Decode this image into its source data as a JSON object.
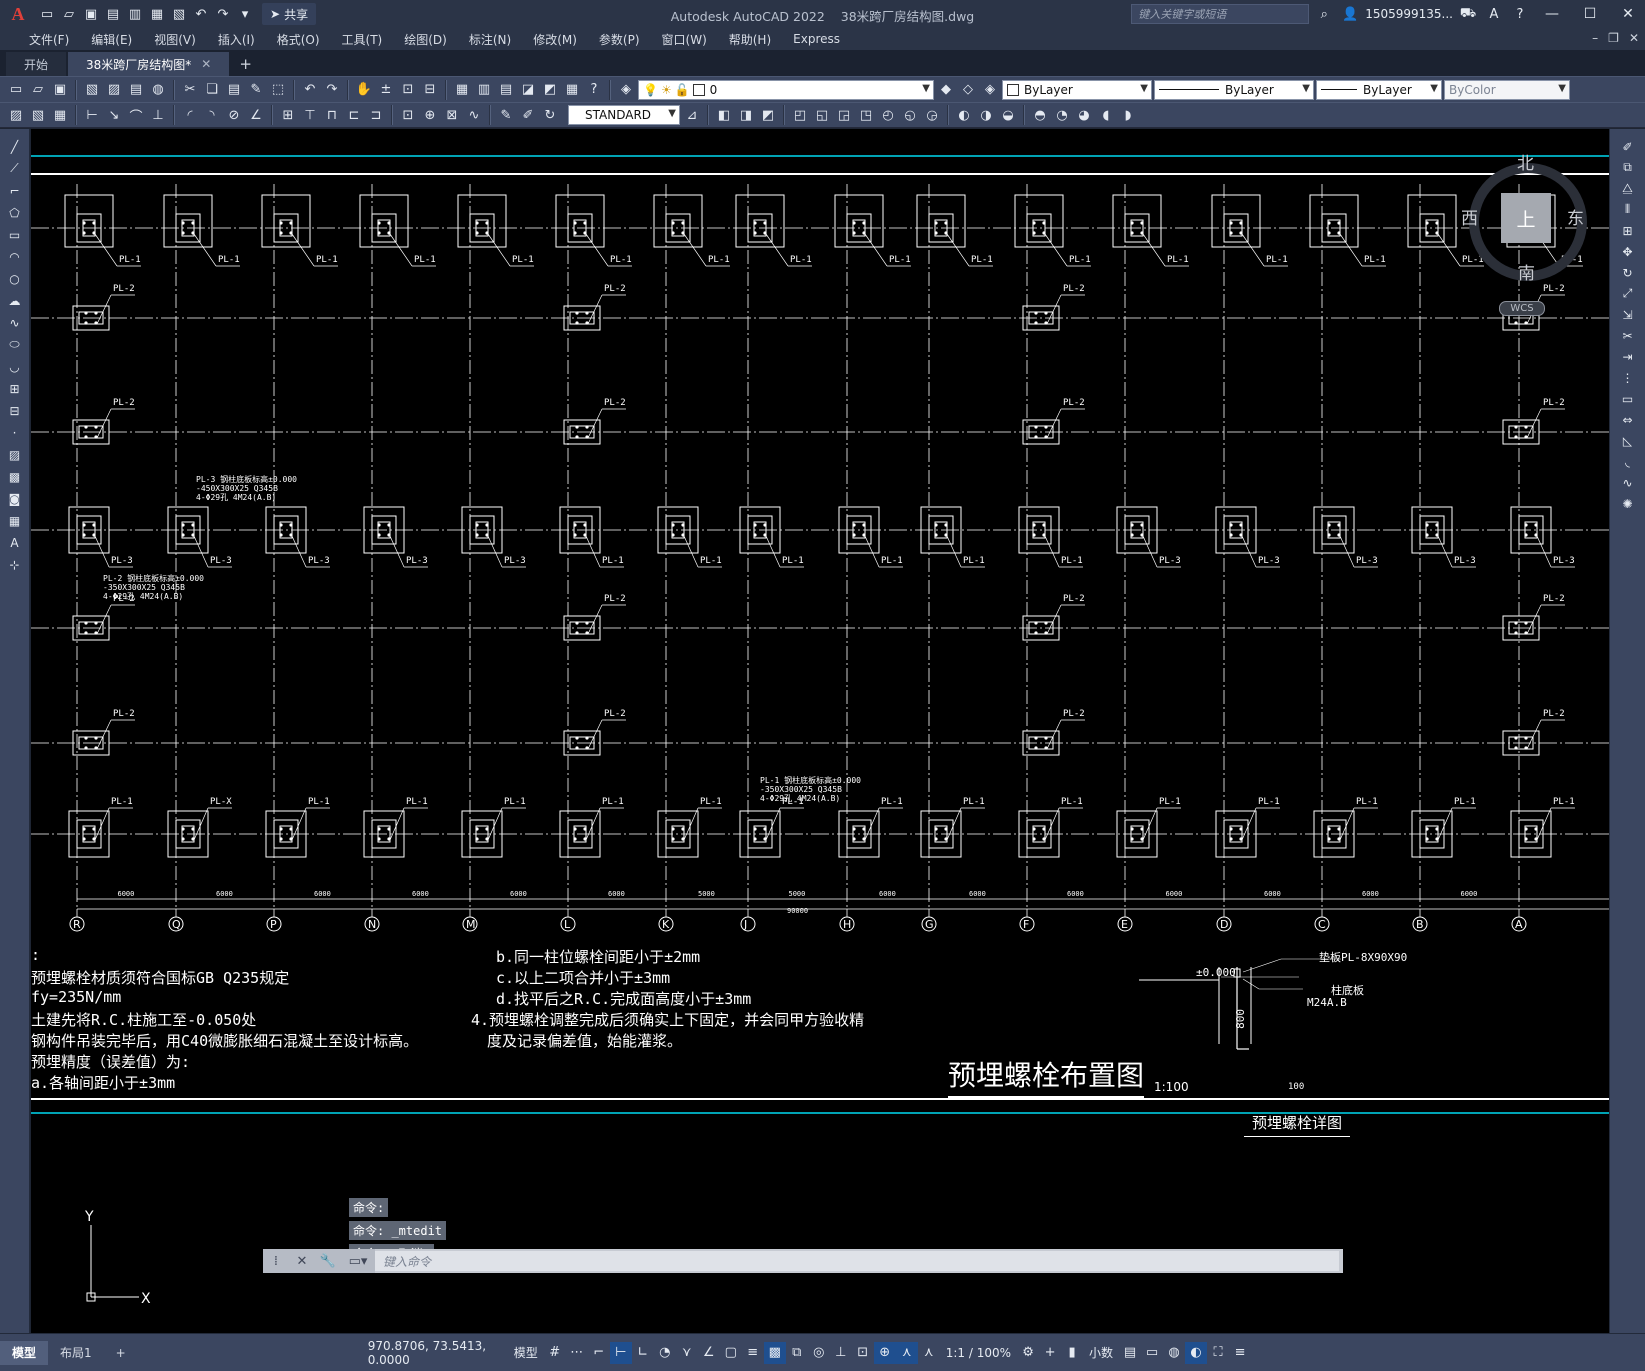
{
  "app": {
    "title": "Autodesk AutoCAD 2022",
    "document": "38米跨厂房结构图.dwg",
    "share_label": "共享",
    "search_placeholder": "键入关键字或短语",
    "user": "1505999135...",
    "logo": "A"
  },
  "menu": [
    "文件(F)",
    "编辑(E)",
    "视图(V)",
    "插入(I)",
    "格式(O)",
    "工具(T)",
    "绘图(D)",
    "标注(N)",
    "修改(M)",
    "参数(P)",
    "窗口(W)",
    "帮助(H)",
    "Express"
  ],
  "tabs": {
    "start": "开始",
    "active": "38米跨厂房结构图*"
  },
  "properties": {
    "layer": "0",
    "color": "ByLayer",
    "linetype": "ByLayer",
    "lineweight": "ByLayer",
    "plotstyle": "ByColor",
    "textstyle": "STANDARD"
  },
  "viewcube": {
    "north": "北",
    "south": "南",
    "east": "东",
    "west": "西",
    "top": "上",
    "wcs": "WCS"
  },
  "drawing": {
    "grid_labels": [
      "R",
      "Q",
      "P",
      "N",
      "M",
      "L",
      "K",
      "J",
      "H",
      "G",
      "F",
      "E",
      "D",
      "C",
      "B",
      "A"
    ],
    "spacing_labels": [
      "6000",
      "6000",
      "6000",
      "6000",
      "6000",
      "6000",
      "5000",
      "5000",
      "6000",
      "6000",
      "6000",
      "6000",
      "6000",
      "6000",
      "6000"
    ],
    "total_span": "90000",
    "pl1": "PL-1",
    "pl2": "PL-2",
    "pl3": "PL-3",
    "plx": "PL-X",
    "pl3_note": [
      "PL-3 钢柱底板标高±0.000",
      "-450X300X25 Q345B",
      "4-Φ29孔 4M24(A.B)"
    ],
    "pl2_note": [
      "PL-2 钢柱底板标高±0.000",
      "-350X300X25 Q345B",
      "4-Φ29孔 4M24(A.B)"
    ],
    "pl1_note": [
      "PL-1 钢柱底板标高±0.000",
      "-350X300X25 Q345B",
      "4-Φ29孔 4M24(A.B)"
    ],
    "notes_left": [
      ":",
      "预埋螺栓材质须符合国标GB Q235规定",
      "fy=235N/mm",
      "土建先将R.C.柱施工至-0.050处",
      "钢构件吊装完毕后，用C40微膨胀细石混凝土至设计标高。",
      "预埋精度（误差值）为:",
      "a.各轴间距小于±3mm"
    ],
    "notes_right": [
      "b.同一柱位螺栓间距小于±2mm",
      "c.以上二项合并小于±3mm",
      "d.找平后之R.C.完成面高度小于±3mm",
      "4.预埋螺栓调整完成后须确实上下固定，并会同甲方验收精",
      "度及记录偏差值，始能灌浆。"
    ],
    "title": "预埋螺栓布置图",
    "scale": "1:100",
    "detail_title": "预埋螺栓详图",
    "detail_elev": "±0.000",
    "detail_washer": "垫板PL-8X90X90",
    "detail_bolt": "M24A.B",
    "detail_dim1": "800",
    "detail_dim2": "100",
    "detail_nut": "柱底板"
  },
  "command": {
    "history": [
      "命令:",
      "命令: _mtedit",
      "命令: *取消*"
    ],
    "placeholder": "键入命令"
  },
  "status": {
    "tab_model": "模型",
    "tab_layout": "布局1",
    "coords": "970.8706, 73.5413, 0.0000",
    "space": "模型",
    "scale": "1:1 / 100%",
    "units": "小数"
  },
  "ucs": {
    "x": "X",
    "y": "Y"
  },
  "colors": {
    "canvas": "#000000",
    "cyan_border": "#00a3b4",
    "ui": "#3b4660"
  }
}
